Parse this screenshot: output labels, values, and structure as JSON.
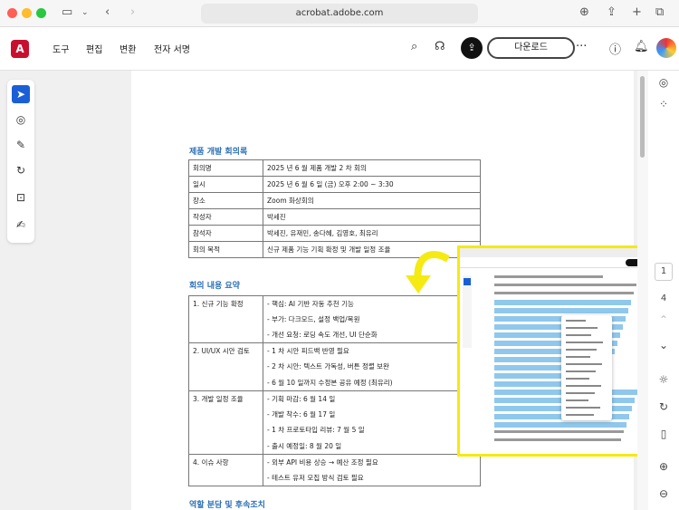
{
  "browser": {
    "url": "acrobat.adobe.com"
  },
  "app": {
    "menu": [
      "도구",
      "편집",
      "변환",
      "전자 서명"
    ],
    "download_label": "다운로드",
    "logo": "Adobe Acrobat"
  },
  "document": {
    "heading1": "제품 개발 회의록",
    "info_table": [
      [
        "회의명",
        "2025 년 6 월 제품 개발 2 차 회의"
      ],
      [
        "일시",
        "2025 년 6 월 6 일 (금) 오후 2:00 ~ 3:30"
      ],
      [
        "장소",
        "Zoom 화상회의"
      ],
      [
        "작성자",
        "박세진"
      ],
      [
        "참석자",
        "박세진, 유재민, 송다혜, 김영호, 최유리"
      ],
      [
        "회의 목적",
        "신규 제품 기능 기획 확정 및 개발 일정 조율"
      ]
    ],
    "heading2": "회의 내용 요약",
    "summary": [
      {
        "topic": "1. 신규 기능 확정",
        "items": [
          "- 핵심: AI 기반 자동 추천 기능",
          "- 부가: 다크모드, 설정 백업/복원",
          "- 개선 요청: 로딩 속도 개선, UI 단순화"
        ]
      },
      {
        "topic": "2. UI/UX 시안 검토",
        "items": [
          "- 1 차 시안 피드백 반영 필요",
          "- 2 차 시안: 텍스트 가독성, 버튼 정렬 보완",
          "- 6 월 10 일까지 수정본 공유 예정 (최유리)"
        ]
      },
      {
        "topic": "3. 개발 일정 조율",
        "items": [
          "- 기획 마감: 6 월 14 일",
          "- 개발 착수: 6 월 17 일",
          "- 1 차 프로토타입 리뷰: 7 월 5 일",
          "- 출시 예정일: 8 월 20 일"
        ]
      },
      {
        "topic": "4. 이슈 사항",
        "items": [
          "- 외부 API 비용 상승 → 예산 조정 필요",
          "- 테스트 유저 모집 방식 검토 필요"
        ]
      }
    ],
    "heading3": "역할 분담 및 후속조치"
  },
  "page_nav": {
    "current": "1",
    "total": "4"
  },
  "colors": {
    "accent": "#2a6fb5",
    "highlight": "#f5ea12",
    "adobe_red": "#c8102e"
  }
}
